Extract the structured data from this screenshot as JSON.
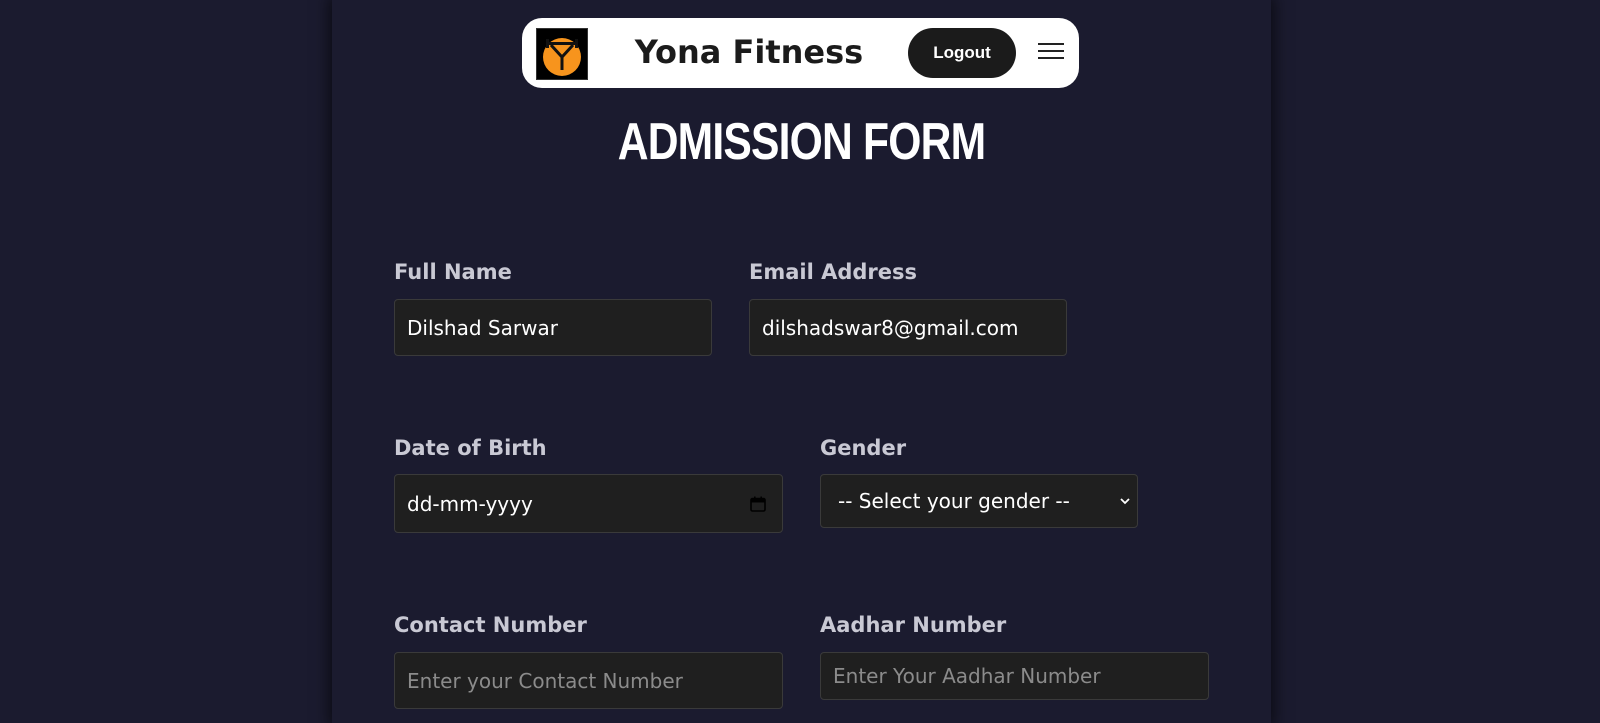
{
  "header": {
    "brand": "Yona Fitness",
    "logout_label": "Logout"
  },
  "form": {
    "title": "ADMISSION FORM",
    "full_name": {
      "label": "Full Name",
      "value": "Dilshad Sarwar"
    },
    "email": {
      "label": "Email Address",
      "value": "dilshadswar8@gmail.com"
    },
    "dob": {
      "label": "Date of Birth",
      "value": "dd-mm-yyyy"
    },
    "gender": {
      "label": "Gender",
      "selected": "-- Select your gender --"
    },
    "contact": {
      "label": "Contact Number",
      "placeholder": "Enter your Contact Number"
    },
    "aadhar": {
      "label": "Aadhar Number",
      "placeholder": "Enter Your Aadhar Number"
    }
  },
  "colors": {
    "background": "#1b1b2f",
    "navbar": "#ffffff",
    "logout_button": "#1b1b1b",
    "field_background": "#1f1f1f",
    "logo_accent": "#f7941d"
  },
  "icons": [
    "logo-icon",
    "hamburger-menu-icon",
    "calendar-icon",
    "chevron-down-icon"
  ]
}
